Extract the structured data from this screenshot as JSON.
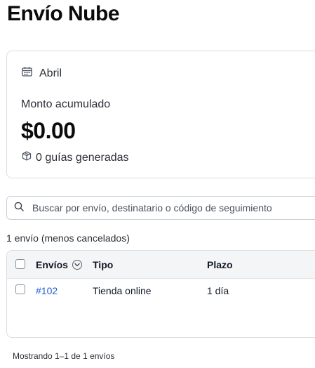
{
  "page": {
    "title": "Envío Nube"
  },
  "summary": {
    "month_icon": "calendar-icon",
    "month": "Abril",
    "amount_label": "Monto acumulado",
    "amount_value": "$0.00",
    "guides_icon": "box-icon",
    "guides_text": "0 guías generadas"
  },
  "search": {
    "icon": "search-icon",
    "placeholder": "Buscar por envío, destinatario o código de seguimiento",
    "value": ""
  },
  "results": {
    "count_text": "1 envío (menos cancelados)"
  },
  "table": {
    "columns": [
      {
        "label": "Envíos",
        "sort_icon": "chevron-down-icon"
      },
      {
        "label": "Tipo"
      },
      {
        "label": "Plazo"
      }
    ],
    "rows": [
      {
        "id": "#102",
        "type": "Tienda online",
        "term": "1 día",
        "selected": false
      }
    ]
  },
  "footer": {
    "text": "Mostrando 1–1 de 1 envíos"
  },
  "colors": {
    "link": "#1f5fd1",
    "border": "#d9dde3",
    "header_bg": "#f4f5f7"
  }
}
